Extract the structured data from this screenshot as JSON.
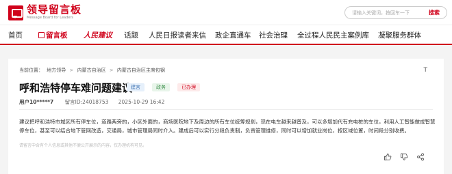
{
  "header": {
    "logo_title": "领导留言板",
    "logo_subtitle": "Message Board for Leaders",
    "search_placeholder": "请输入关键词，按回车一下",
    "search_button": "搜索"
  },
  "nav": {
    "items": [
      "首页",
      "留言板",
      "人民建议",
      "话题",
      "人民日报读者来信",
      "政企直通车",
      "社会治理",
      "全过程人民民主案例库",
      "凝聚服务群体"
    ]
  },
  "article": {
    "breadcrumb": [
      "当前位置：",
      "地方领导",
      ">",
      "内蒙古自治区",
      ">",
      "内蒙古自治区主席包钢"
    ],
    "text_size_label": "T",
    "title": "呼和浩特停车难问题建议",
    "tags": [
      "建言",
      "政务",
      "已办理"
    ],
    "user": "用户10*****7",
    "message_id": "留言ID:24018753",
    "date": "2025-10-29 16:42",
    "content": "建议把呼和浩特市城区所有停车位，道路两旁的，小区外面的，商场医院地下及周边的所有车位统筹规划，现在电车越来越普及，可以多增加代有充电桩的车位，利用人工智能做成智慧停车位，甚至可以结合地下管网改造，交通局，城市管理局同时介入。建成后可以实行分段负责制，负责管理维修，同时可以增加就业岗位，按区域位置，时间段分别收费。",
    "disclaimer": "请留言中含有个人信息或其他不便公开展示的内容，仅办理机构可见。"
  },
  "colors": {
    "brand_red": "#d0021b"
  },
  "icons": [
    "like-icon",
    "dislike-icon",
    "share-icon"
  ]
}
